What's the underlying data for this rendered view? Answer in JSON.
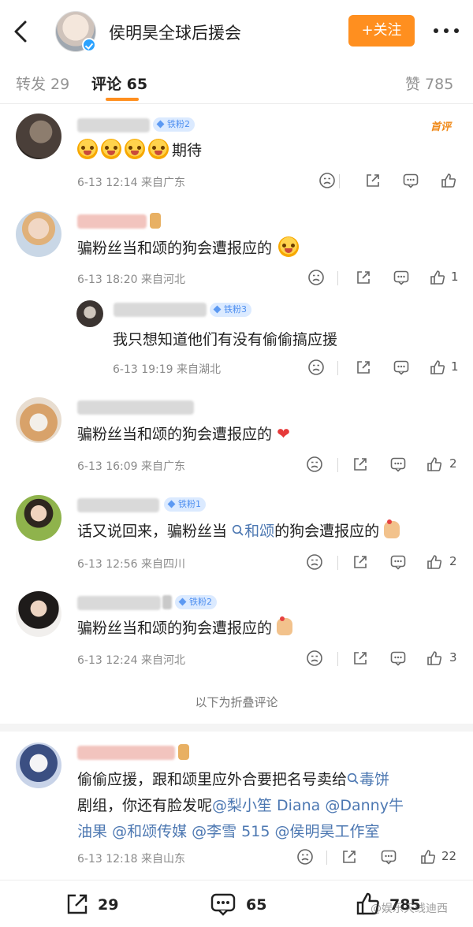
{
  "header": {
    "title": "侯明昊全球后援会",
    "follow_label": "+关注"
  },
  "tabs": {
    "repost": "转发 29",
    "comments": "评论 65",
    "likes": "赞 785"
  },
  "colors": {
    "accent": "#ff8f1f",
    "link": "#4d78b2",
    "fan_badge": "#4d8ef0",
    "first_tag": "#f08a1a"
  },
  "comments": [
    {
      "badge": "铁粉2",
      "first_tag": "首评",
      "text": "期待",
      "meta": "6-13 12:14  来自广东",
      "likes": ""
    },
    {
      "badge": "",
      "text": "骗粉丝当和颂的狗会遭报应的",
      "meta": "6-13 18:20  来自河北",
      "likes": "1"
    },
    {
      "badge": "",
      "text": "骗粉丝当和颂的狗会遭报应的",
      "meta": "6-13 16:09  来自广东",
      "likes": "2"
    },
    {
      "badge": "铁粉1",
      "text_a": "话又说回来，骗粉丝当",
      "link": "和颂",
      "text_b": "的狗会遭报应的",
      "meta": "6-13 12:56  来自四川",
      "likes": "2"
    },
    {
      "badge": "铁粉2",
      "text": "骗粉丝当和颂的狗会遭报应的",
      "meta": "6-13 12:24  来自河北",
      "likes": "3"
    }
  ],
  "reply": {
    "badge": "铁粉3",
    "text": "我只想知道他们有没有偷偷搞应援",
    "meta": "6-13 19:19  来自湖北",
    "likes": "1"
  },
  "folded_note": "以下为折叠评论",
  "folded_comment": {
    "line1_a": "偷偷应援，跟和颂里应外合要把名号卖给",
    "line1_link": "毒饼",
    "line2_a": "剧组，你还有脸发呢",
    "mention1": "@梨小笙 Diana",
    "mention2": "@Danny牛",
    "line3_a": "油果",
    "mention3": "@和颂传媒",
    "mention4": "@李雪 515",
    "mention5": "@侯明昊工作室",
    "meta": "6-13 12:18  来自山东",
    "likes": "22"
  },
  "bottom": {
    "reposts": "29",
    "comments": "65",
    "likes": "785"
  },
  "watermark": "@娱乐天线迪西"
}
